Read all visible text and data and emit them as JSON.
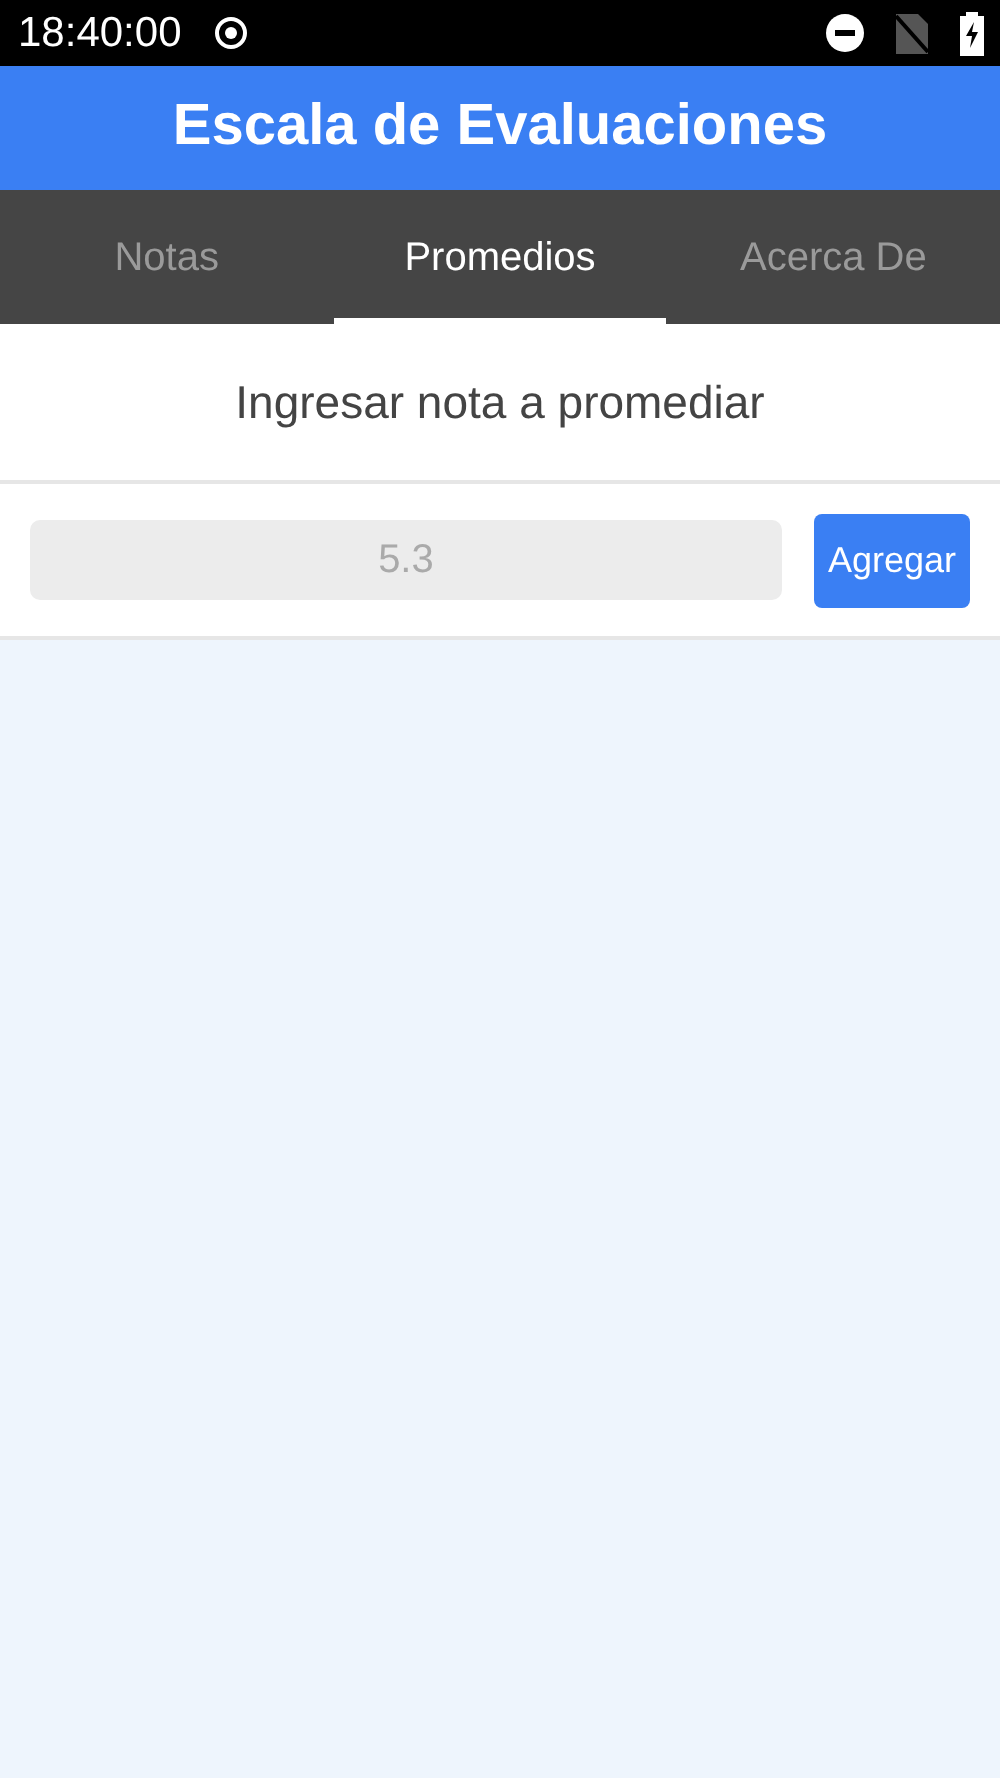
{
  "status_bar": {
    "time": "18:40:00"
  },
  "app_bar": {
    "title": "Escala de Evaluaciones"
  },
  "tabs": [
    {
      "label": "Notas",
      "selected": false
    },
    {
      "label": "Promedios",
      "selected": true
    },
    {
      "label": "Acerca De",
      "selected": false
    }
  ],
  "form": {
    "heading": "Ingresar nota a promediar",
    "grade_field": {
      "placeholder": "5.3"
    },
    "add_button": "Agregar"
  }
}
